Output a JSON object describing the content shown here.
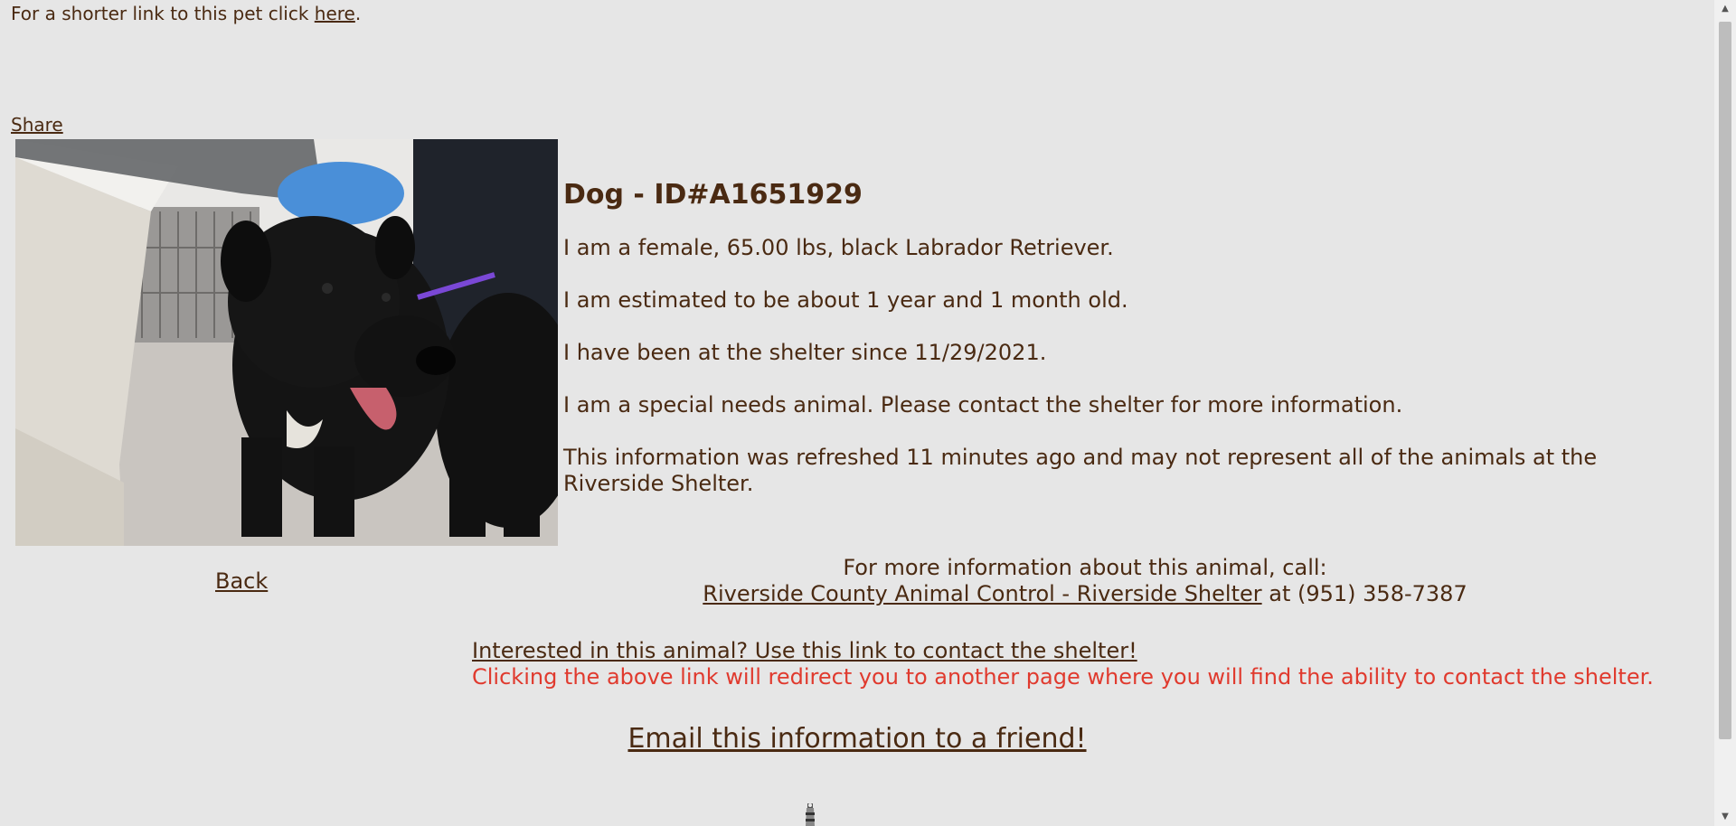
{
  "header": {
    "shorter_link_prefix": "For a shorter link to this pet click ",
    "shorter_link_text": "here",
    "shorter_link_suffix": "."
  },
  "share_label": "Share",
  "back_label": "Back",
  "animal": {
    "title": "Dog - ID#A1651929",
    "description": "I am a female, 65.00 lbs, black Labrador Retriever.",
    "age": "I am estimated to be about 1 year and 1 month old.",
    "since": "I have been at the shelter since 11/29/2021.",
    "special_needs": "I am a special needs animal. Please contact the shelter for more information.",
    "refresh_note": "This information was refreshed 11 minutes ago and may not represent all of the animals at the Riverside Shelter."
  },
  "contact": {
    "intro": "For more information about this animal, call:",
    "shelter_link": "Riverside County Animal Control - Riverside Shelter",
    "phone_text": " at (951) 358-7387"
  },
  "interested": {
    "link_text": "Interested in this animal? Use this link to contact the shelter!",
    "note": "Clicking the above link will redirect you to another page where you will find the ability to contact the shelter."
  },
  "email_friend_label": "Email this information to a friend!",
  "colors": {
    "background": "#e6e6e6",
    "text": "#4a2a12",
    "warning": "#e03a2e"
  },
  "icons": {
    "bottom": "lighthouse-icon",
    "scroll_up": "scroll-up-arrow-icon",
    "scroll_down": "scroll-down-arrow-icon"
  }
}
